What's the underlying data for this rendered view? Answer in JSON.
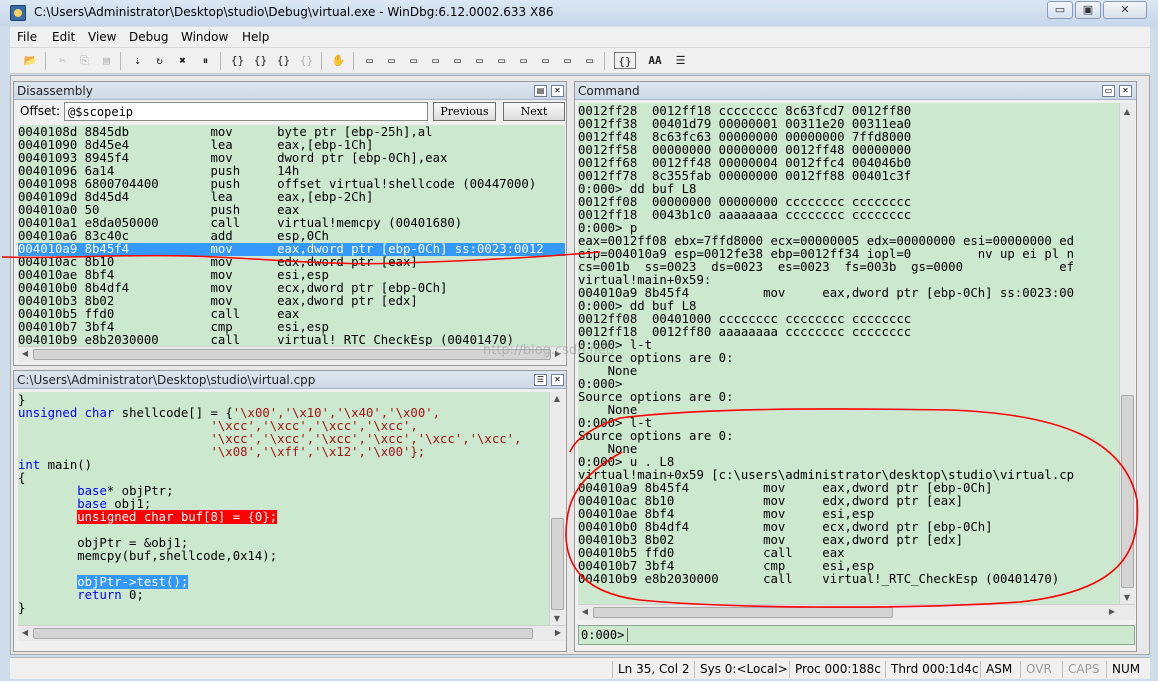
{
  "window": {
    "title": "C:\\Users\\Administrator\\Desktop\\studio\\Debug\\virtual.exe - WinDbg:6.12.0002.633 X86",
    "minimize": "▭",
    "maximize": "▣",
    "close": "✕"
  },
  "menu": [
    "File",
    "Edit",
    "View",
    "Debug",
    "Window",
    "Help"
  ],
  "toolbar": {
    "icons": [
      "open-icon",
      "cut-icon",
      "copy-icon",
      "paste-icon",
      "go-icon",
      "restart-icon",
      "stop-debugging-icon",
      "break-icon",
      "step-into-icon",
      "step-over-icon",
      "step-out-icon",
      "run-to-cursor-icon",
      "insert-breakpoint-icon",
      "command-window-icon",
      "watch-window-icon",
      "locals-window-icon",
      "registers-window-icon",
      "memory-window-icon",
      "call-stack-icon",
      "disassembly-window-icon",
      "scratch-pad-icon",
      "processes-threads-icon",
      "source-mode-icon",
      "font-icon",
      "options-icon"
    ],
    "source_mode_label": "{}",
    "font_label": "AA"
  },
  "disassembly": {
    "title": "Disassembly",
    "offset_label": "Offset:",
    "offset_value": "@$scopeip",
    "previous_label": "Previous",
    "next_label": "Next",
    "lines": [
      {
        "addr": "0040108d",
        "bytes": "8845db",
        "op": "mov",
        "args": "byte ptr [ebp-25h],al"
      },
      {
        "addr": "00401090",
        "bytes": "8d45e4",
        "op": "lea",
        "args": "eax,[ebp-1Ch]"
      },
      {
        "addr": "00401093",
        "bytes": "8945f4",
        "op": "mov",
        "args": "dword ptr [ebp-0Ch],eax"
      },
      {
        "addr": "00401096",
        "bytes": "6a14",
        "op": "push",
        "args": "14h"
      },
      {
        "addr": "00401098",
        "bytes": "6800704400",
        "op": "push",
        "args": "offset virtual!shellcode (00447000)"
      },
      {
        "addr": "0040109d",
        "bytes": "8d45d4",
        "op": "lea",
        "args": "eax,[ebp-2Ch]"
      },
      {
        "addr": "004010a0",
        "bytes": "50",
        "op": "push",
        "args": "eax"
      },
      {
        "addr": "004010a1",
        "bytes": "e8da050000",
        "op": "call",
        "args": "virtual!memcpy (00401680)"
      },
      {
        "addr": "004010a6",
        "bytes": "83c40c",
        "op": "add",
        "args": "esp,0Ch"
      },
      {
        "addr": "004010a9",
        "bytes": "8b45f4",
        "op": "mov",
        "args": "eax,dword ptr [ebp-0Ch] ss:0023:0012"
      },
      {
        "addr": "004010ac",
        "bytes": "8b10",
        "op": "mov",
        "args": "edx,dword ptr [eax]"
      },
      {
        "addr": "004010ae",
        "bytes": "8bf4",
        "op": "mov",
        "args": "esi,esp"
      },
      {
        "addr": "004010b0",
        "bytes": "8b4df4",
        "op": "mov",
        "args": "ecx,dword ptr [ebp-0Ch]"
      },
      {
        "addr": "004010b3",
        "bytes": "8b02",
        "op": "mov",
        "args": "eax,dword ptr [edx]"
      },
      {
        "addr": "004010b5",
        "bytes": "ffd0",
        "op": "call",
        "args": "eax"
      },
      {
        "addr": "004010b7",
        "bytes": "3bf4",
        "op": "cmp",
        "args": "esi,esp"
      },
      {
        "addr": "004010b9",
        "bytes": "e8b2030000",
        "op": "call",
        "args": "virtual!_RTC_CheckEsp (00401470)"
      }
    ],
    "current_index": 9
  },
  "source": {
    "title": "C:\\Users\\Administrator\\Desktop\\studio\\virtual.cpp",
    "lines": [
      {
        "text": "}",
        "style": "plain"
      },
      {
        "text": "unsigned char shellcode[] = {'\\x00','\\x10','\\x40','\\x00',",
        "style": "mixed1"
      },
      {
        "text": "                          '\\xcc','\\xcc','\\xcc','\\xcc',",
        "style": "str"
      },
      {
        "text": "                          '\\xcc','\\xcc','\\xcc','\\xcc','\\xcc','\\xcc',",
        "style": "str"
      },
      {
        "text": "                          '\\x08','\\xff','\\x12','\\x00'};",
        "style": "str"
      },
      {
        "text": "int main()",
        "style": "mixed2"
      },
      {
        "text": "{",
        "style": "plain"
      },
      {
        "text": "        base* objPtr;",
        "style": "mixed3"
      },
      {
        "text": "        base obj1;",
        "style": "mixed3"
      },
      {
        "text": "        unsigned char buf[8] = {0};",
        "style": "redbar"
      },
      {
        "text": "",
        "style": "plain"
      },
      {
        "text": "        objPtr = &obj1;",
        "style": "plain"
      },
      {
        "text": "        memcpy(buf,shellcode,0x14);",
        "style": "plain"
      },
      {
        "text": "",
        "style": "plain"
      },
      {
        "text": "        objPtr->test();",
        "style": "bluebar"
      },
      {
        "text": "        return 0;",
        "style": "mixed4"
      },
      {
        "text": "}",
        "style": "plain"
      }
    ]
  },
  "command": {
    "title": "Command",
    "lines": [
      "0012ff28  0012ff18 cccccccc 8c63fcd7 0012ff80",
      "0012ff38  00401d79 00000001 00311e20 00311ea0",
      "0012ff48  8c63fc63 00000000 00000000 7ffd8000",
      "0012ff58  00000000 00000000 0012ff48 00000000",
      "0012ff68  0012ff48 00000004 0012ffc4 004046b0",
      "0012ff78  8c355fab 00000000 0012ff88 00401c3f",
      "0:000> dd buf L8",
      "0012ff08  00000000 00000000 cccccccc cccccccc",
      "0012ff18  0043b1c0 aaaaaaaa cccccccc cccccccc",
      "0:000> p",
      "eax=0012ff08 ebx=7ffd8000 ecx=00000005 edx=00000000 esi=00000000 ed",
      "eip=004010a9 esp=0012fe38 ebp=0012ff34 iopl=0         nv up ei pl n",
      "cs=001b  ss=0023  ds=0023  es=0023  fs=003b  gs=0000             ef",
      "virtual!main+0x59:",
      "004010a9 8b45f4          mov     eax,dword ptr [ebp-0Ch] ss:0023:00",
      "0:000> dd buf L8",
      "0012ff08  00401000 cccccccc cccccccc cccccccc",
      "0012ff18  0012ff80 aaaaaaaa cccccccc cccccccc",
      "0:000> l-t",
      "Source options are 0:",
      "    None",
      "0:000>",
      "Source options are 0:",
      "    None",
      "0:000> l-t",
      "Source options are 0:",
      "    None",
      "0:000> u . L8",
      "virtual!main+0x59 [c:\\users\\administrator\\desktop\\studio\\virtual.cp",
      "004010a9 8b45f4          mov     eax,dword ptr [ebp-0Ch]",
      "004010ac 8b10            mov     edx,dword ptr [eax]",
      "004010ae 8bf4            mov     esi,esp",
      "004010b0 8b4df4          mov     ecx,dword ptr [ebp-0Ch]",
      "004010b3 8b02            mov     eax,dword ptr [edx]",
      "004010b5 ffd0            call    eax",
      "004010b7 3bf4            cmp     esi,esp",
      "004010b9 e8b2030000      call    virtual!_RTC_CheckEsp (00401470)"
    ],
    "prompt": "0:000>",
    "input_value": ""
  },
  "status": {
    "position": "Ln 35, Col 2",
    "sys": "Sys 0:<Local>",
    "proc": "Proc 000:188c",
    "thrd": "Thrd 000:1d4c",
    "asm": "ASM",
    "ovr": "OVR",
    "caps": "CAPS",
    "num": "NUM"
  },
  "watermark": "http://blog.csdn.net/",
  "colors": {
    "code_bg": "#cce8cf",
    "highlight": "#3399ff",
    "breakpoint": "#ff0000",
    "annotation": "#ff0000"
  }
}
